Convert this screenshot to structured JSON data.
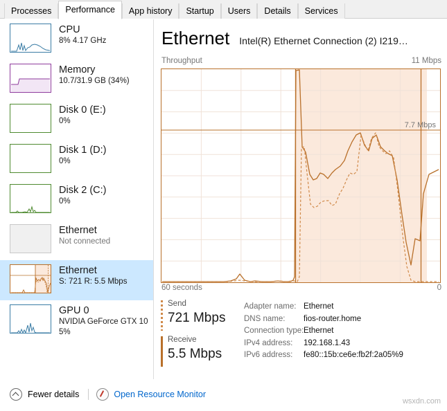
{
  "tabs": [
    {
      "label": "Processes",
      "active": false
    },
    {
      "label": "Performance",
      "active": true
    },
    {
      "label": "App history",
      "active": false
    },
    {
      "label": "Startup",
      "active": false
    },
    {
      "label": "Users",
      "active": false
    },
    {
      "label": "Details",
      "active": false
    },
    {
      "label": "Services",
      "active": false
    }
  ],
  "sidebar": {
    "items": [
      {
        "title": "CPU",
        "sub": "8% 4.17 GHz",
        "color": "#3a7ca5",
        "selected": false,
        "muted": false
      },
      {
        "title": "Memory",
        "sub": "10.7/31.9 GB (34%)",
        "color": "#8e3a9c",
        "selected": false,
        "muted": false
      },
      {
        "title": "Disk 0 (E:)",
        "sub": "0%",
        "color": "#4e8a2f",
        "selected": false,
        "muted": false
      },
      {
        "title": "Disk 1 (D:)",
        "sub": "0%",
        "color": "#4e8a2f",
        "selected": false,
        "muted": false
      },
      {
        "title": "Disk 2 (C:)",
        "sub": "0%",
        "color": "#4e8a2f",
        "selected": false,
        "muted": false
      },
      {
        "title": "Ethernet",
        "sub": "Not connected",
        "color": "#c8c8c8",
        "selected": false,
        "muted": true
      },
      {
        "title": "Ethernet",
        "sub": "S: 721 R: 5.5 Mbps",
        "color": "#b9702a",
        "selected": true,
        "muted": false
      },
      {
        "title": "GPU 0",
        "sub": "NVIDIA GeForce GTX 10",
        "sub2": "5%",
        "color": "#3a7ca5",
        "selected": false,
        "muted": false
      }
    ]
  },
  "main": {
    "title": "Ethernet",
    "subtitle": "Intel(R) Ethernet Connection (2) I219…",
    "chart_label": "Throughput",
    "chart_max": "11 Mbps",
    "chart_annotation": "7.7 Mbps",
    "axis_left": "60 seconds",
    "axis_right": "0",
    "send": {
      "name": "Send",
      "value": "721 Mbps"
    },
    "receive": {
      "name": "Receive",
      "value": "5.5 Mbps"
    },
    "adapter": [
      {
        "key": "Adapter name:",
        "value": "Ethernet"
      },
      {
        "key": "DNS name:",
        "value": "fios-router.home"
      },
      {
        "key": "Connection type:",
        "value": "Ethernet"
      },
      {
        "key": "IPv4 address:",
        "value": "192.168.1.43"
      },
      {
        "key": "IPv6 address:",
        "value": "fe80::15b:ce6e:fb2f:2a05%9"
      }
    ]
  },
  "footer": {
    "fewer_details": "Fewer details",
    "open_resource_monitor": "Open Resource Monitor"
  },
  "watermark": "wsxdn.com",
  "colors": {
    "accent_orange": "#b9702a",
    "fill_orange": "#fbe9dc",
    "send_dotted": "#d08a4a",
    "selection_blue": "#cce8ff",
    "link_blue": "#0066cc"
  },
  "chart_data": {
    "type": "area",
    "title": "Throughput",
    "ylabel": "Mbps",
    "xlabel": "seconds",
    "ylim": [
      0,
      11
    ],
    "xlim": [
      60,
      0
    ],
    "grid": true,
    "annotation": {
      "text": "7.7 Mbps",
      "y": 7.7
    },
    "series": [
      {
        "name": "Receive",
        "style": "solid",
        "x": [
          60,
          57,
          54,
          51,
          48,
          45,
          42,
          39,
          36,
          33,
          30,
          27,
          25,
          23,
          22,
          21,
          20,
          19,
          18,
          17,
          16,
          15,
          14,
          13,
          12,
          11,
          10,
          9,
          8,
          7,
          6,
          5,
          4,
          3,
          2,
          1,
          0
        ],
        "values": [
          0,
          0,
          0,
          0,
          0,
          0,
          0,
          0,
          0.05,
          0.1,
          0.3,
          0.8,
          0.2,
          1.9,
          0.5,
          0.1,
          0.1,
          0.1,
          0.2,
          0.2,
          11,
          6.5,
          5.0,
          5.0,
          5.0,
          5.0,
          5.0,
          5.2,
          5.4,
          6.2,
          7.6,
          6.6,
          7.1,
          6.0,
          6.2,
          0.9,
          4.4
        ]
      },
      {
        "name": "Send",
        "style": "dashed",
        "x": [
          60,
          57,
          54,
          51,
          48,
          45,
          42,
          39,
          36,
          33,
          30,
          27,
          24,
          22,
          21,
          20,
          19,
          18,
          17,
          16,
          15,
          14,
          13,
          12,
          11,
          10,
          9,
          8,
          7,
          6,
          5,
          4,
          3,
          2,
          1,
          0
        ],
        "values": [
          0,
          0,
          0,
          0,
          0,
          0,
          0,
          0,
          0,
          0,
          0.1,
          0.1,
          0.15,
          0.1,
          0.1,
          0.1,
          0.1,
          0.15,
          0.1,
          8.0,
          5.0,
          4.6,
          4.9,
          5.3,
          5.6,
          5.2,
          4.8,
          5.6,
          6.3,
          7.5,
          6.6,
          7.2,
          6.1,
          0.3,
          0.1,
          0.1
        ]
      }
    ],
    "highlight_region": {
      "from_x": 20,
      "to_x": 1,
      "fill": "#fbe9dc"
    }
  }
}
